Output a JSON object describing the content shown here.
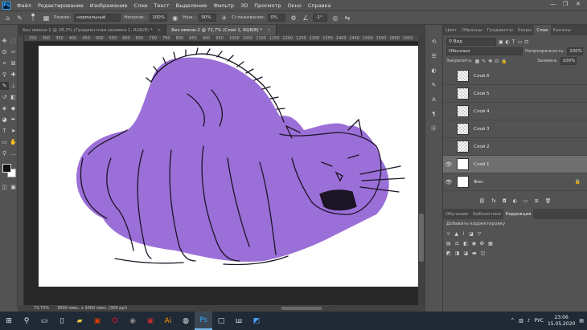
{
  "menubar": {
    "logo": "Ps",
    "items": [
      "Файл",
      "Редактирование",
      "Изображение",
      "Слои",
      "Текст",
      "Выделение",
      "Фильтр",
      "3D",
      "Просмотр",
      "Окно",
      "Справка"
    ]
  },
  "options": {
    "mode_label": "Режим:",
    "mode_value": "нормальный",
    "opacity_label": "Непрозр.:",
    "opacity_value": "100%",
    "flow_label": "Наж.:",
    "flow_value": "90%",
    "smoothing_label": "Сглаживание:",
    "smoothing_value": "0%",
    "angle_value": "-1°",
    "brush_size": "7"
  },
  "doc_tabs": [
    {
      "label": "Без имени-1 @ 28,3% (Градиентная заливка 1, RGB/8) *",
      "active": false
    },
    {
      "label": "Без имени-2 @ 72,7% (Слой 1, RGB/8) *",
      "active": true
    }
  ],
  "ruler_ticks": [
    "250",
    "300",
    "350",
    "400",
    "450",
    "500",
    "550",
    "600",
    "650",
    "700",
    "750",
    "800",
    "850",
    "900",
    "950",
    "1000",
    "1050",
    "1100",
    "1150",
    "1200",
    "1250",
    "1300",
    "1350",
    "1400",
    "1450",
    "1500",
    "1550",
    "1600",
    "1650"
  ],
  "status": {
    "zoom": "72,73%",
    "info": "3000 пикс. x 3000 пикс. (300 ppi)"
  },
  "panels": {
    "top_tabs": [
      "Цвет",
      "Образцы",
      "Градиенты",
      "Узоры",
      "Слои",
      "Каналы"
    ],
    "active_top_tab": "Слои",
    "filter_kind": "Вид",
    "blend_mode": "Обычные",
    "opacity_label": "Непрозрачность:",
    "opacity_value": "100%",
    "lock_label": "Закрепить:",
    "fill_label": "Заливка:",
    "fill_value": "100%",
    "layers": [
      {
        "name": "Слой 6",
        "visible": false,
        "selected": false
      },
      {
        "name": "Слой 5",
        "visible": false,
        "selected": false
      },
      {
        "name": "Слой 4",
        "visible": false,
        "selected": false
      },
      {
        "name": "Слой 3",
        "visible": false,
        "selected": false
      },
      {
        "name": "Слой 2",
        "visible": false,
        "selected": false
      },
      {
        "name": "Слой 1",
        "visible": true,
        "selected": true
      },
      {
        "name": "Фон",
        "visible": true,
        "selected": false
      }
    ],
    "bottom_tabs": [
      "Обучение",
      "Библиотеки",
      "Коррекция"
    ],
    "active_bottom_tab": "Коррекция",
    "adjust_title": "Добавить корректировку"
  },
  "taskbar": {
    "lang": "РУС",
    "time": "23:06",
    "date": "15.05.2020"
  },
  "colors": {
    "cat_fill": "#9b6fd8",
    "ui_bg": "#535353",
    "canvas_bg": "#282828"
  }
}
